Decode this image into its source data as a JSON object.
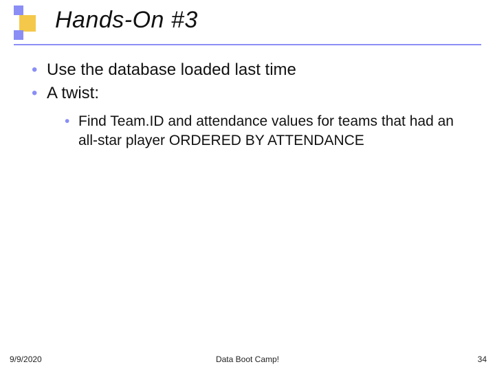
{
  "title": "Hands-On #3",
  "bullets": {
    "lvl1": [
      "Use the database loaded last time",
      "A twist:"
    ],
    "lvl2": [
      "Find Team.ID and attendance values for teams that had an all-star player ORDERED BY ATTENDANCE"
    ]
  },
  "footer": {
    "date": "9/9/2020",
    "center": "Data Boot Camp!",
    "page": "34"
  }
}
